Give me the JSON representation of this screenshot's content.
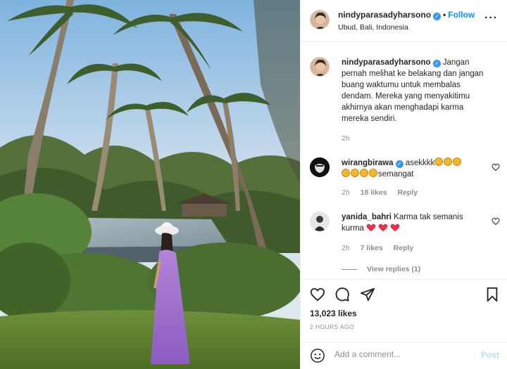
{
  "header": {
    "username": "nindyparasadyharsono",
    "follow_label": "Follow",
    "location": "Ubud, Bali, Indonesia",
    "more_icon": "more-horizontal-icon"
  },
  "caption": {
    "username": "nindyparasadyharsono",
    "text": "Jangan pernah melihat ke belakang dan jangan buang waktumu untuk membalas dendam. Mereka yang menyakitimu akhirnya akan menghadapi karma mereka sendiri.",
    "time": "2h"
  },
  "comments": [
    {
      "username": "wirangbirawa",
      "text_a": "asekkkk",
      "text_b": "semangat",
      "time": "2h",
      "likes": "18 likes",
      "reply_label": "Reply"
    },
    {
      "username": "yanida_bahri",
      "text": "Karma tak semanis kurma",
      "time": "2h",
      "likes": "7 likes",
      "reply_label": "Reply"
    }
  ],
  "view_replies": "View replies (1)",
  "actions": {
    "likes": "13,023 likes",
    "posted_time": "2 HOURS AGO"
  },
  "add_comment": {
    "placeholder": "Add a comment...",
    "post_label": "Post"
  },
  "colors": {
    "accent": "#0095f6",
    "verified": "#3897f0",
    "heart": "#ed4956"
  }
}
